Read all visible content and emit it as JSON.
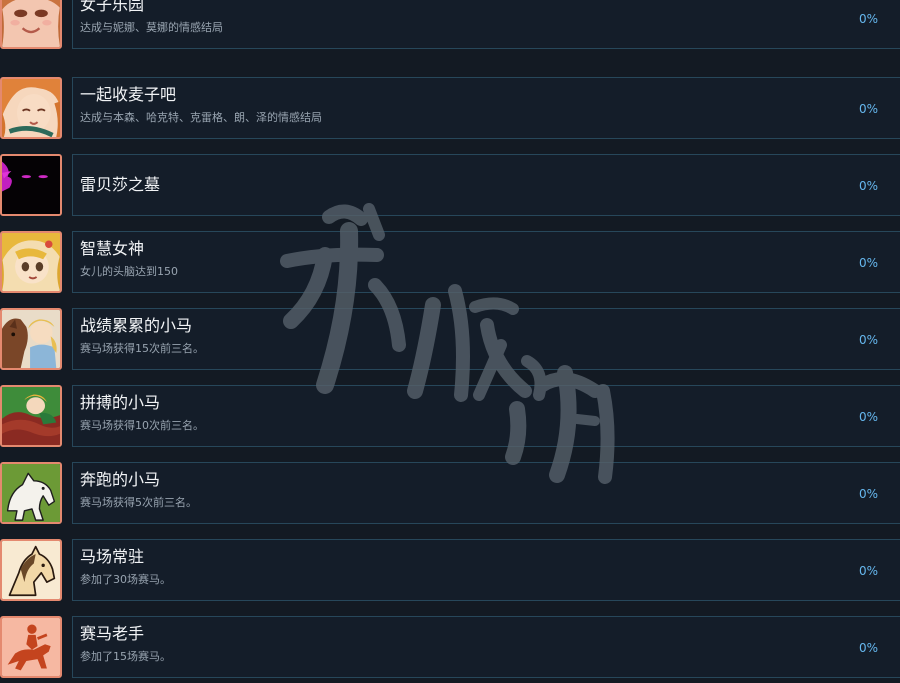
{
  "achievements": [
    {
      "title": "女子乐园",
      "desc": "达成与妮娜、莫娜的情感结局",
      "percent": "0%",
      "icon": "girl-smiling-portrait"
    },
    {
      "title": "一起收麦子吧",
      "desc": "达成与本森、哈克特、克雷格、朗、泽的情感结局",
      "percent": "0%",
      "icon": "ginger-girl-eyes-closed-portrait"
    },
    {
      "title": "雷贝莎之墓",
      "desc": "",
      "percent": "0%",
      "icon": "shadow-figure-glowing-eyes"
    },
    {
      "title": "智慧女神",
      "desc": "女儿的头脑达到150",
      "percent": "0%",
      "icon": "blonde-girl-portrait"
    },
    {
      "title": "战绩累累的小马",
      "desc": "赛马场获得15次前三名。",
      "percent": "0%",
      "icon": "girl-with-brown-horse"
    },
    {
      "title": "拼搏的小马",
      "desc": "赛马场获得10次前三名。",
      "percent": "0%",
      "icon": "girl-riding-horse"
    },
    {
      "title": "奔跑的小马",
      "desc": "赛马场获得5次前三名。",
      "percent": "0%",
      "icon": "white-horse"
    },
    {
      "title": "马场常驻",
      "desc": "参加了30场赛马。",
      "percent": "0%",
      "icon": "horse-head"
    },
    {
      "title": "赛马老手",
      "desc": "参加了15场赛马。",
      "percent": "0%",
      "icon": "jockey-on-horse"
    }
  ],
  "watermark": {
    "text": "游侠网"
  },
  "colors": {
    "background": "#131a23",
    "card": "#141d29",
    "card_border": "#27475a",
    "percent": "#66b8ef",
    "icon_border": "#e4896f"
  }
}
